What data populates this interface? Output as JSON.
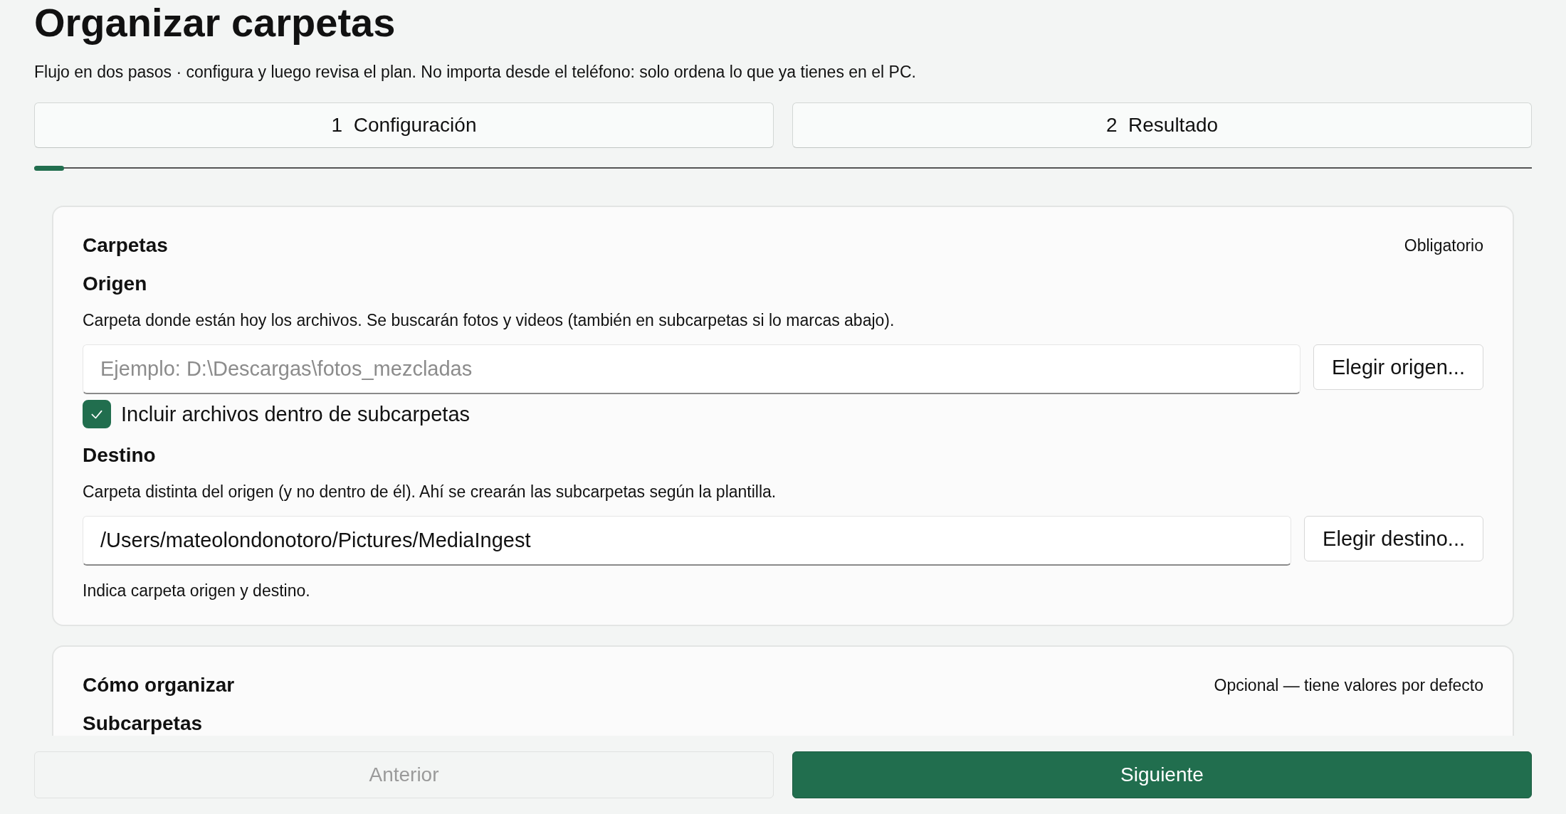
{
  "title": "Organizar carpetas",
  "subtitle": "Flujo en dos pasos · configura y luego revisa el plan. No importa desde el teléfono: solo ordena lo que ya tienes en el PC.",
  "steps": [
    {
      "number": "1",
      "label": "Configuración"
    },
    {
      "number": "2",
      "label": "Resultado"
    }
  ],
  "progress": {
    "level": 0.02
  },
  "sections": [
    {
      "title": "Carpetas",
      "tag": "Obligatorio",
      "fields": [
        {
          "label": "Origen",
          "description": "Carpeta donde están hoy los archivos. Se buscarán fotos y videos (también en subcarpetas si lo marcas abajo).",
          "placeholder": "Ejemplo: D:\\Descargas\\fotos_mezcladas",
          "button": "Elegir origen...",
          "checkbox": {
            "label": "Incluir archivos dentro de subcarpetas",
            "checked": true
          }
        },
        {
          "label": "Destino",
          "description": "Carpeta distinta del origen (y no dentro de él). Ahí se crearán las subcarpetas según la plantilla.",
          "value": "/Users/mateolondonotoro/Pictures/MediaIngest",
          "button": "Elegir destino..."
        }
      ],
      "note": "Indica carpeta origen y destino."
    },
    {
      "title": "Cómo organizar",
      "tag": "Opcional — tiene valores por defecto",
      "subheading": "Subcarpetas"
    }
  ],
  "footer": [
    {
      "label": "Anterior",
      "kind": "secondary",
      "disabled": true
    },
    {
      "label": "Siguiente",
      "kind": "primary",
      "disabled": false
    }
  ]
}
